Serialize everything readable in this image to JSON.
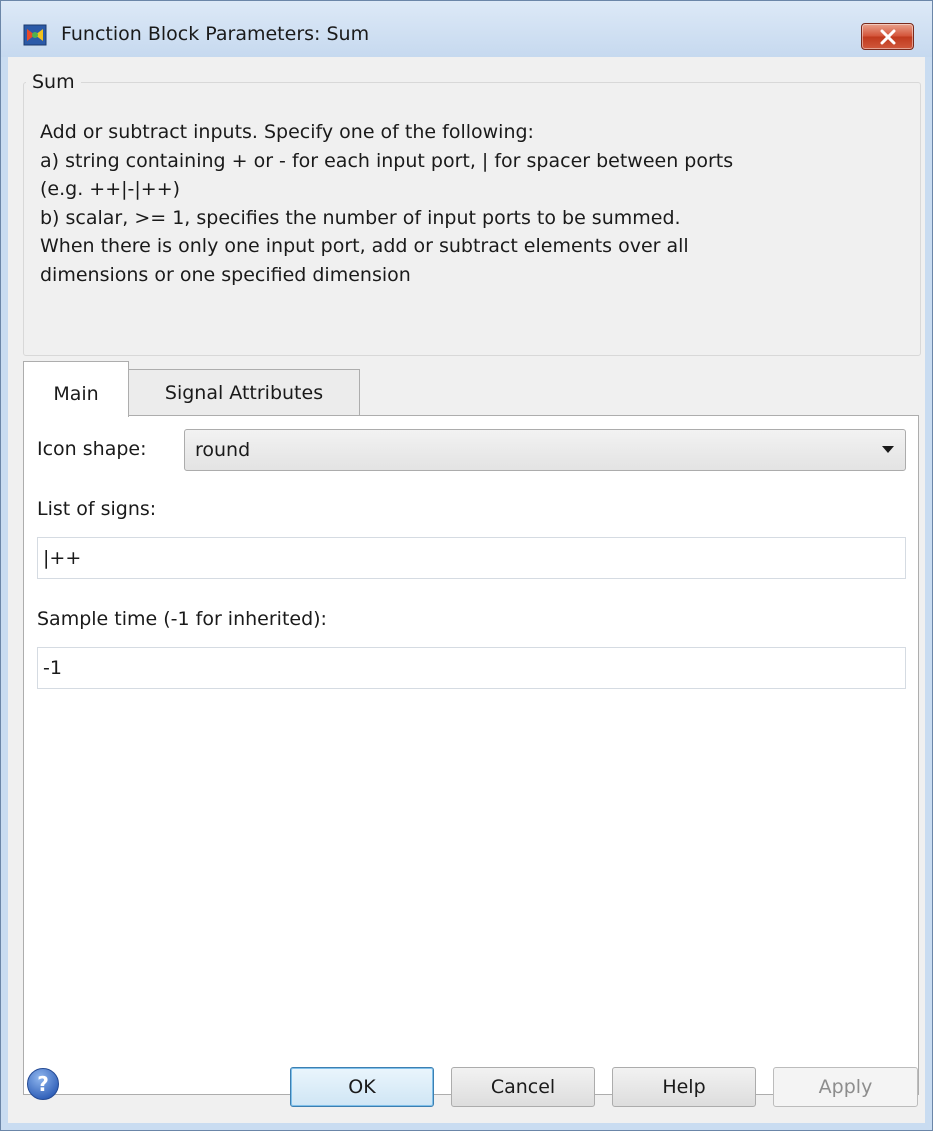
{
  "window": {
    "title": "Function Block Parameters: Sum",
    "app_icon": "simulink-icon",
    "close_icon": "close-icon"
  },
  "group": {
    "legend": "Sum",
    "description_lines": [
      "Add or subtract inputs.  Specify one of the following:",
      "a) string containing + or - for each input port, | for spacer between ports",
      "(e.g. ++|-|++)",
      "b) scalar, >= 1, specifies the number of input ports to be summed.",
      "When there is only one input port, add or subtract elements over all",
      "dimensions or one specified dimension"
    ]
  },
  "tabs": [
    {
      "label": "Main",
      "active": true
    },
    {
      "label": "Signal Attributes",
      "active": false
    }
  ],
  "main": {
    "icon_shape": {
      "label": "Icon shape:",
      "value": "round"
    },
    "list_of_signs": {
      "label": "List of signs:",
      "value": "|++"
    },
    "sample_time": {
      "label": "Sample time (-1 for inherited):",
      "value": "-1"
    }
  },
  "buttons": {
    "help_icon": "help-question-icon",
    "ok": "OK",
    "cancel": "Cancel",
    "help": "Help",
    "apply": "Apply",
    "apply_enabled": false
  },
  "colors": {
    "titlebar": "#c9dcf1",
    "close_button": "#c9452a",
    "default_button_border": "#3c7fb1"
  }
}
